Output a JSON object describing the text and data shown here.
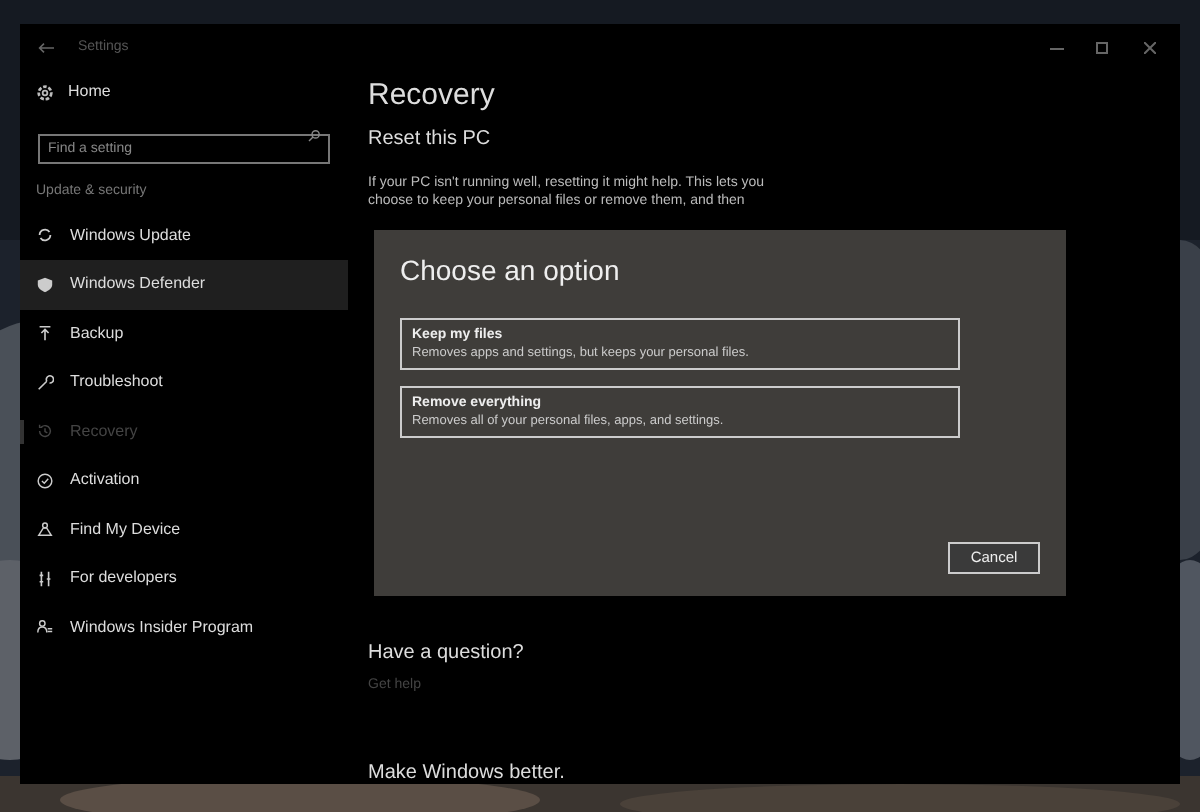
{
  "window": {
    "title": "Settings"
  },
  "sidebar": {
    "home": "Home",
    "search": {
      "placeholder": "Find a setting"
    },
    "section": "Update & security",
    "items": [
      {
        "label": "Windows Update",
        "selected": false,
        "hovered": false
      },
      {
        "label": "Windows Defender",
        "selected": false,
        "hovered": true
      },
      {
        "label": "Backup",
        "selected": false,
        "hovered": false
      },
      {
        "label": "Troubleshoot",
        "selected": false,
        "hovered": false
      },
      {
        "label": "Recovery",
        "selected": true,
        "hovered": false
      },
      {
        "label": "Activation",
        "selected": false,
        "hovered": false
      },
      {
        "label": "Find My Device",
        "selected": false,
        "hovered": false
      },
      {
        "label": "For developers",
        "selected": false,
        "hovered": false
      },
      {
        "label": "Windows Insider Program",
        "selected": false,
        "hovered": false
      }
    ]
  },
  "page": {
    "title": "Recovery",
    "section": "Reset this PC",
    "description": "If your PC isn't running well, resetting it might help. This lets you choose to keep your personal files or remove them, and then",
    "question": "Have a question?",
    "help_link": "Get help",
    "footer": "Make Windows better."
  },
  "dialog": {
    "title": "Choose an option",
    "options": [
      {
        "title": "Keep my files",
        "description": "Removes apps and settings, but keeps your personal files."
      },
      {
        "title": "Remove everything",
        "description": "Removes all of your personal files, apps, and settings."
      }
    ],
    "buttons": [
      "Cancel"
    ]
  }
}
